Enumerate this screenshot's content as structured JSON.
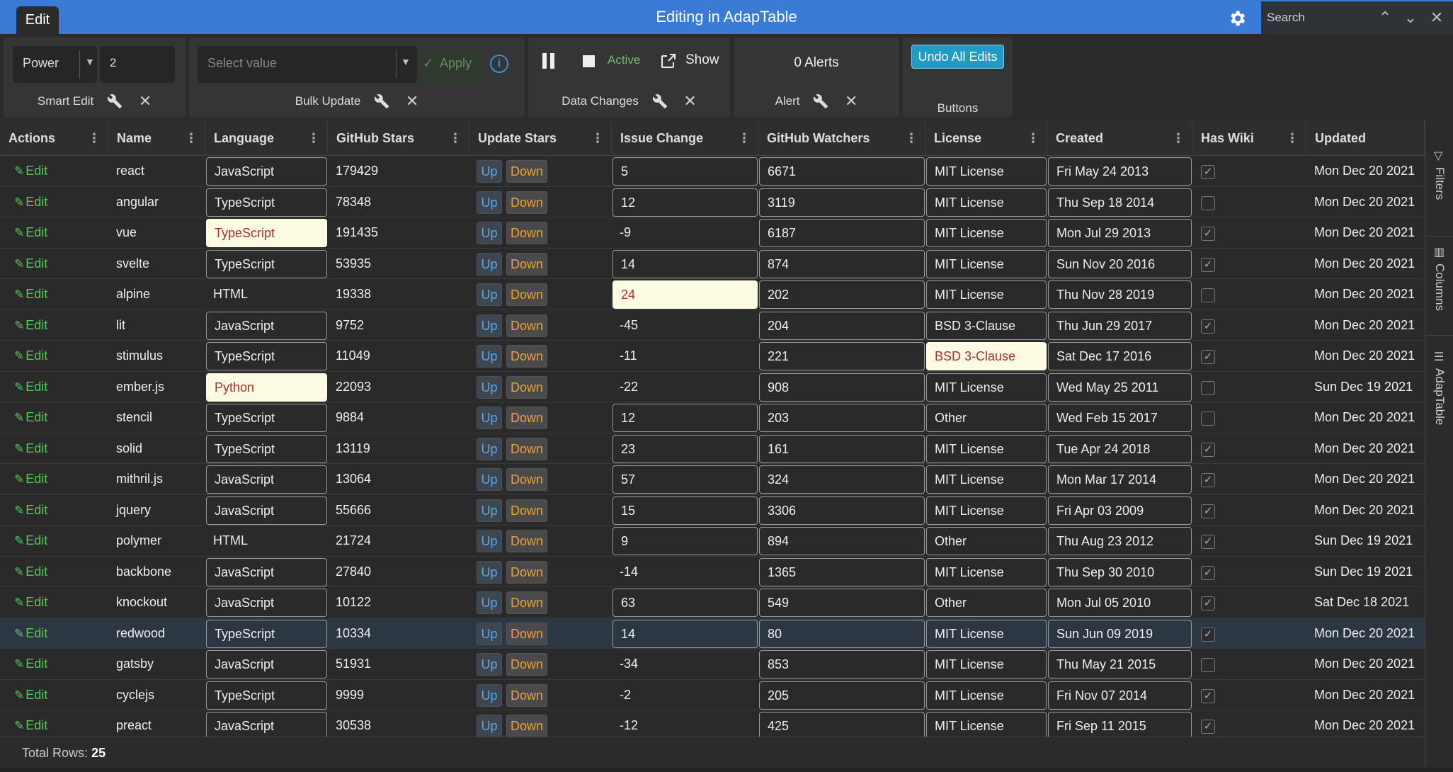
{
  "header": {
    "tab": "Edit",
    "title": "Editing in AdapTable",
    "search_placeholder": "Search"
  },
  "dashboard": {
    "smart_edit": {
      "operation": "Power",
      "value": "2",
      "label": "Smart Edit"
    },
    "bulk_update": {
      "placeholder": "Select value",
      "apply": "Apply",
      "label": "Bulk Update"
    },
    "data_changes": {
      "status": "Active",
      "show": "Show",
      "label": "Data Changes"
    },
    "alert": {
      "count_text": "0 Alerts",
      "label": "Alert"
    },
    "buttons": {
      "undo": "Undo All Edits",
      "label": "Buttons"
    }
  },
  "columns": [
    "Actions",
    "Name",
    "Language",
    "GitHub Stars",
    "Update Stars",
    "Issue Change",
    "GitHub Watchers",
    "License",
    "Created",
    "Has Wiki",
    "Updated"
  ],
  "action_label": "Edit",
  "up_label": "Up",
  "down_label": "Down",
  "rows": [
    {
      "name": "react",
      "language": "JavaScript",
      "stars": "179429",
      "issue": "5",
      "watchers": "6671",
      "license": "MIT License",
      "created": "Fri May 24 2013",
      "wiki": true,
      "updated": "Mon Dec 20 2021"
    },
    {
      "name": "angular",
      "language": "TypeScript",
      "stars": "78348",
      "issue": "12",
      "watchers": "3119",
      "license": "MIT License",
      "created": "Thu Sep 18 2014",
      "wiki": false,
      "updated": "Mon Dec 20 2021"
    },
    {
      "name": "vue",
      "language": "TypeScript",
      "stars": "191435",
      "issue": "-9",
      "watchers": "6187",
      "license": "MIT License",
      "created": "Mon Jul 29 2013",
      "wiki": true,
      "updated": "Mon Dec 20 2021"
    },
    {
      "name": "svelte",
      "language": "TypeScript",
      "stars": "53935",
      "issue": "14",
      "watchers": "874",
      "license": "MIT License",
      "created": "Sun Nov 20 2016",
      "wiki": true,
      "updated": "Mon Dec 20 2021"
    },
    {
      "name": "alpine",
      "language": "HTML",
      "stars": "19338",
      "issue": "24",
      "watchers": "202",
      "license": "MIT License",
      "created": "Thu Nov 28 2019",
      "wiki": false,
      "updated": "Mon Dec 20 2021"
    },
    {
      "name": "lit",
      "language": "JavaScript",
      "stars": "9752",
      "issue": "-45",
      "watchers": "204",
      "license": "BSD 3-Clause",
      "created": "Thu Jun 29 2017",
      "wiki": true,
      "updated": "Mon Dec 20 2021"
    },
    {
      "name": "stimulus",
      "language": "TypeScript",
      "stars": "11049",
      "issue": "-11",
      "watchers": "221",
      "license": "BSD 3-Clause",
      "created": "Sat Dec 17 2016",
      "wiki": true,
      "updated": "Mon Dec 20 2021"
    },
    {
      "name": "ember.js",
      "language": "Python",
      "stars": "22093",
      "issue": "-22",
      "watchers": "908",
      "license": "MIT License",
      "created": "Wed May 25 2011",
      "wiki": false,
      "updated": "Sun Dec 19 2021"
    },
    {
      "name": "stencil",
      "language": "TypeScript",
      "stars": "9884",
      "issue": "12",
      "watchers": "203",
      "license": "Other",
      "created": "Wed Feb 15 2017",
      "wiki": false,
      "updated": "Mon Dec 20 2021"
    },
    {
      "name": "solid",
      "language": "TypeScript",
      "stars": "13119",
      "issue": "23",
      "watchers": "161",
      "license": "MIT License",
      "created": "Tue Apr 24 2018",
      "wiki": true,
      "updated": "Mon Dec 20 2021"
    },
    {
      "name": "mithril.js",
      "language": "JavaScript",
      "stars": "13064",
      "issue": "57",
      "watchers": "324",
      "license": "MIT License",
      "created": "Mon Mar 17 2014",
      "wiki": true,
      "updated": "Mon Dec 20 2021"
    },
    {
      "name": "jquery",
      "language": "JavaScript",
      "stars": "55666",
      "issue": "15",
      "watchers": "3306",
      "license": "MIT License",
      "created": "Fri Apr 03 2009",
      "wiki": true,
      "updated": "Mon Dec 20 2021"
    },
    {
      "name": "polymer",
      "language": "HTML",
      "stars": "21724",
      "issue": "9",
      "watchers": "894",
      "license": "Other",
      "created": "Thu Aug 23 2012",
      "wiki": true,
      "updated": "Sun Dec 19 2021"
    },
    {
      "name": "backbone",
      "language": "JavaScript",
      "stars": "27840",
      "issue": "-14",
      "watchers": "1365",
      "license": "MIT License",
      "created": "Thu Sep 30 2010",
      "wiki": true,
      "updated": "Sun Dec 19 2021"
    },
    {
      "name": "knockout",
      "language": "JavaScript",
      "stars": "10122",
      "issue": "63",
      "watchers": "549",
      "license": "Other",
      "created": "Mon Jul 05 2010",
      "wiki": true,
      "updated": "Sat Dec 18 2021"
    },
    {
      "name": "redwood",
      "language": "TypeScript",
      "stars": "10334",
      "issue": "14",
      "watchers": "80",
      "license": "MIT License",
      "created": "Sun Jun 09 2019",
      "wiki": true,
      "updated": "Mon Dec 20 2021"
    },
    {
      "name": "gatsby",
      "language": "JavaScript",
      "stars": "51931",
      "issue": "-34",
      "watchers": "853",
      "license": "MIT License",
      "created": "Thu May 21 2015",
      "wiki": false,
      "updated": "Mon Dec 20 2021"
    },
    {
      "name": "cyclejs",
      "language": "TypeScript",
      "stars": "9999",
      "issue": "-2",
      "watchers": "205",
      "license": "MIT License",
      "created": "Fri Nov 07 2014",
      "wiki": true,
      "updated": "Mon Dec 20 2021"
    },
    {
      "name": "preact",
      "language": "JavaScript",
      "stars": "30538",
      "issue": "-12",
      "watchers": "425",
      "license": "MIT License",
      "created": "Fri Sep 11 2015",
      "wiki": true,
      "updated": "Mon Dec 20 2021"
    }
  ],
  "footer": {
    "label": "Total Rows:",
    "count": "25"
  },
  "sidebar": {
    "filters": "Filters",
    "columns": "Columns",
    "adaptable": "AdapTable"
  },
  "colors": {
    "accent": "#3a7bd5",
    "edited_bg": "#fdfbe2",
    "edited_text": "#a6322a",
    "up": "#5aa8e8",
    "down": "#e9a23a",
    "action": "#5cc35a"
  }
}
